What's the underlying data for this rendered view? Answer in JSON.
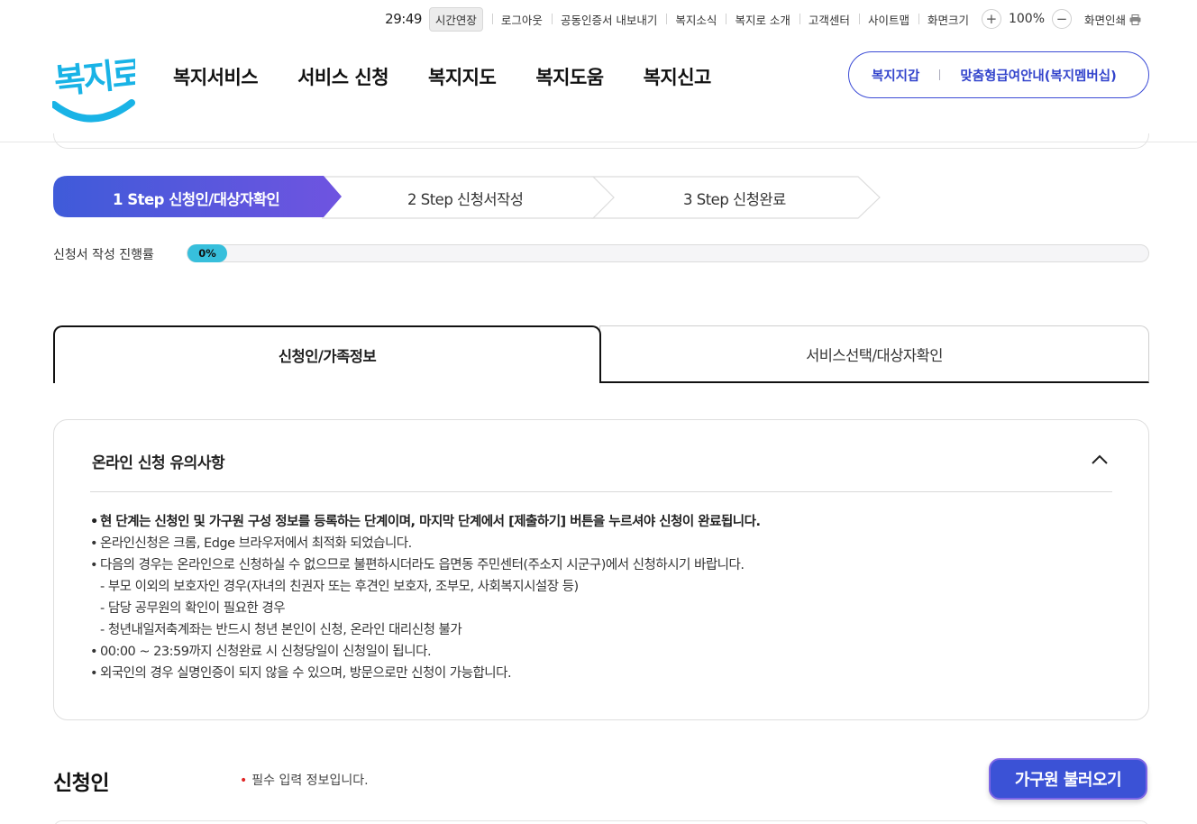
{
  "utility": {
    "timer": "29:49",
    "extend_label": "시간연장",
    "links": [
      "로그아웃",
      "공동인증서 내보내기",
      "복지소식",
      "복지로 소개",
      "고객센터",
      "사이트맵",
      "화면크기"
    ],
    "zoom_in": "+",
    "zoom_value": "100%",
    "zoom_out": "−",
    "print_label": "화면인쇄"
  },
  "header": {
    "logo_text": "복지로",
    "nav": [
      "복지서비스",
      "서비스 신청",
      "복지지도",
      "복지도움",
      "복지신고"
    ],
    "quick_links": [
      "복지지갑",
      "맞춤형급여안내(복지멤버십)"
    ]
  },
  "colors": {
    "brand_blue": "#3b52d6",
    "step_gradient_start": "#3f5bd9",
    "step_gradient_end": "#6f54e0",
    "progress_fill": "#37bfdc",
    "logo_cyan": "#19b3e6",
    "required_dot": "#e02424"
  },
  "steps": [
    {
      "label": "1 Step 신청인/대상자확인",
      "active": true
    },
    {
      "label": "2 Step 신청서작성",
      "active": false
    },
    {
      "label": "3 Step 신청완료",
      "active": false
    }
  ],
  "progress": {
    "label": "신청서 작성 진행률",
    "value_text": "0%",
    "value": 0
  },
  "tabs": [
    {
      "label": "신청인/가족정보",
      "active": true
    },
    {
      "label": "서비스선택/대상자확인",
      "active": false
    }
  ],
  "notice": {
    "title": "온라인 신청 유의사항",
    "toggle_icon": "chevron-up-icon",
    "items": [
      {
        "text": "현 단계는 신청인 및 가구원 구성 정보를 등록하는 단계이며, 마지막 단계에서 [제출하기] 버튼을 누르셔야 신청이 완료됩니다.",
        "type": "strong"
      },
      {
        "text": "온라인신청은 크롬, Edge 브라우저에서 최적화 되었습니다.",
        "type": "bullet"
      },
      {
        "text": "다음의 경우는 온라인으로 신청하실 수 없으므로 불편하시더라도 읍면동 주민센터(주소지 시군구)에서 신청하시기 바랍니다.",
        "type": "bullet"
      },
      {
        "text": "- 부모 이외의 보호자인 경우(자녀의 친권자 또는 후견인 보호자, 조부모, 사회복지시설장 등)",
        "type": "sub"
      },
      {
        "text": "- 담당 공무원의 확인이 필요한 경우",
        "type": "sub"
      },
      {
        "text": "- 청년내일저축계좌는 반드시 청년 본인이 신청, 온라인 대리신청 불가",
        "type": "sub"
      },
      {
        "text": "00:00 ~ 23:59까지 신청완료 시 신청당일이 신청일이 됩니다.",
        "type": "bullet"
      },
      {
        "text": "외국인의 경우 실명인증이 되지 않을 수 있으며, 방문으로만 신청이 가능합니다.",
        "type": "bullet"
      }
    ]
  },
  "applicant": {
    "title": "신청인",
    "required_dot": "•",
    "required_note": "필수 입력 정보입니다.",
    "load_button": "가구원 불러오기"
  }
}
